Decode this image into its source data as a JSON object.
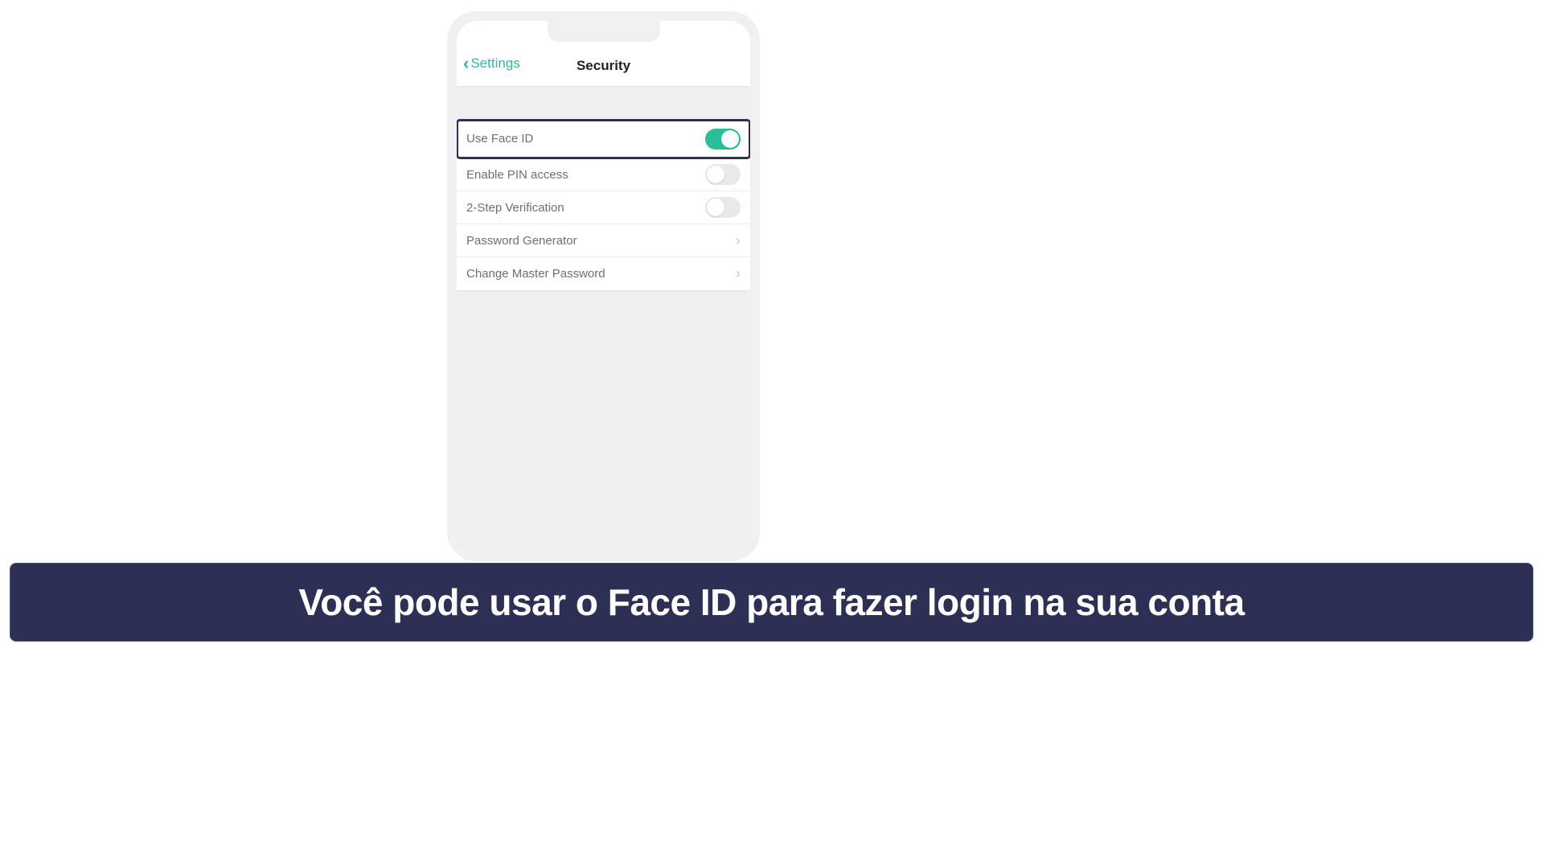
{
  "nav": {
    "back_label": "Settings",
    "title": "Security"
  },
  "rows": [
    {
      "label": "Use Face ID",
      "type": "toggle",
      "on": true,
      "highlight": true
    },
    {
      "label": "Enable PIN access",
      "type": "toggle",
      "on": false,
      "highlight": false
    },
    {
      "label": "2-Step Verification",
      "type": "toggle",
      "on": false,
      "highlight": false
    },
    {
      "label": "Password Generator",
      "type": "link",
      "highlight": false
    },
    {
      "label": "Change Master Password",
      "type": "link",
      "highlight": false
    }
  ],
  "caption": "Você pode usar o Face ID para fazer login na sua conta",
  "colors": {
    "accent": "#29bd9a",
    "dark": "#2e2f55"
  }
}
